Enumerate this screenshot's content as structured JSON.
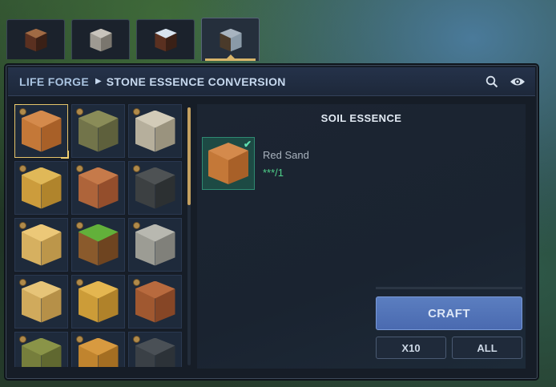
{
  "tabs": [
    {
      "name": "tab-soil",
      "colors": [
        "#a06a44",
        "#5a3020",
        "#3a2016"
      ],
      "active": false
    },
    {
      "name": "tab-stone",
      "colors": [
        "#c8c4bc",
        "#9e9a92",
        "#7a766e"
      ],
      "active": false
    },
    {
      "name": "tab-mixed",
      "colors": [
        "#d8e4f0",
        "#5a3020",
        "#3a2016"
      ],
      "active": false
    },
    {
      "name": "tab-essence-conversion",
      "colors": [
        "#a8b4c0",
        "#4a3a2a",
        "#8a9aa8"
      ],
      "active": true
    }
  ],
  "breadcrumb": {
    "root": "LIFE FORGE",
    "current": "STONE ESSENCE CONVERSION"
  },
  "grid": [
    {
      "name": "red-sand-block",
      "colors": [
        "#d48a4c",
        "#c47838",
        "#a86028"
      ],
      "selected": true
    },
    {
      "name": "mossy-earth-block",
      "colors": [
        "#8a8c58",
        "#72744a",
        "#5e603c"
      ],
      "selected": false
    },
    {
      "name": "gravel-block",
      "colors": [
        "#d2cbb8",
        "#b6af9c",
        "#9a937e"
      ],
      "selected": false
    },
    {
      "name": "sand-block",
      "colors": [
        "#e0b858",
        "#cc9c3c",
        "#b0842c"
      ],
      "selected": false
    },
    {
      "name": "clay-block",
      "colors": [
        "#c67a4a",
        "#ae643a",
        "#944e2c"
      ],
      "selected": false
    },
    {
      "name": "dark-gravel-block",
      "colors": [
        "#4e5254",
        "#3c4042",
        "#2c3032"
      ],
      "selected": false
    },
    {
      "name": "sandstone-block",
      "colors": [
        "#ecc878",
        "#d6b060",
        "#bc964a"
      ],
      "selected": false
    },
    {
      "name": "grass-block",
      "colors": [
        "#62b03a",
        "#8a5a2c",
        "#6e4420"
      ],
      "selected": false
    },
    {
      "name": "stone-block",
      "colors": [
        "#b8b8b0",
        "#9c9c94",
        "#80807a"
      ],
      "selected": false
    },
    {
      "name": "pale-sand-block",
      "colors": [
        "#e6c478",
        "#d0aa5c",
        "#b69048"
      ],
      "selected": false
    },
    {
      "name": "yellow-sand-block",
      "colors": [
        "#e4b650",
        "#cc9c38",
        "#b0822a"
      ],
      "selected": false
    },
    {
      "name": "terracotta-block",
      "colors": [
        "#b86a3e",
        "#a05830",
        "#864626"
      ],
      "selected": false
    },
    {
      "name": "moss-block",
      "colors": [
        "#8a9448",
        "#767e3c",
        "#606830"
      ],
      "selected": false
    },
    {
      "name": "ochre-block",
      "colors": [
        "#d89a40",
        "#c0842e",
        "#a46e22"
      ],
      "selected": false
    },
    {
      "name": "slate-block",
      "colors": [
        "#4a5056",
        "#3a4046",
        "#2c3238"
      ],
      "selected": false
    }
  ],
  "panel": {
    "title": "SOIL ESSENCE",
    "ingredient": {
      "name": "Red Sand",
      "quantity": "***/1",
      "colors": [
        "#d48a4c",
        "#c47838",
        "#a86028"
      ]
    }
  },
  "buttons": {
    "craft": "CRAFT",
    "x10": "X10",
    "all": "ALL"
  }
}
